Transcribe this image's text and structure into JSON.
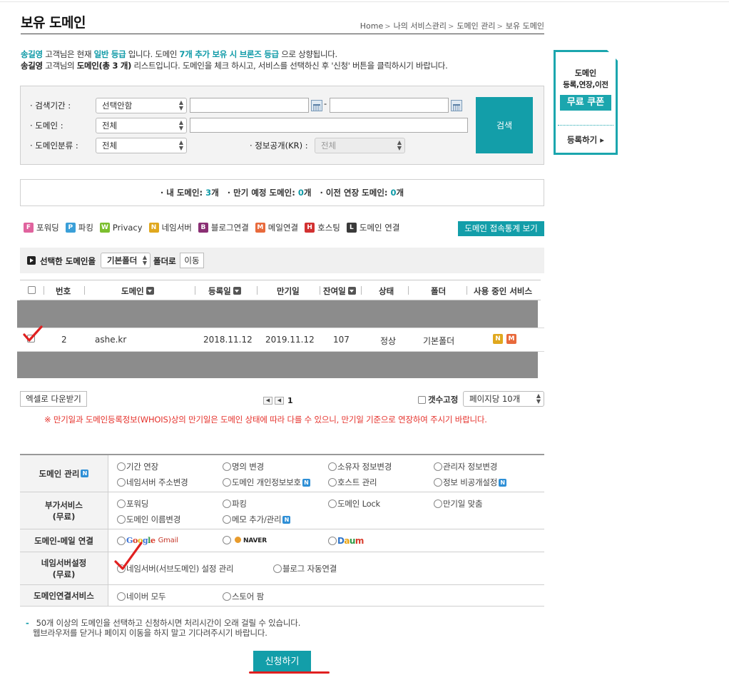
{
  "page": {
    "title": "보유 도메인",
    "breadcrumb": [
      "Home",
      "나의 서비스관리",
      "도메인 관리",
      "보유 도메인"
    ]
  },
  "notice": {
    "line1_name": "송길영",
    "line1_a": " 고객님은 현재 ",
    "line1_grade": "일반 등급",
    "line1_b": " 입니다. 도메인 ",
    "line1_more": "7개 추가 보유 시 브론즈 등급",
    "line1_c": " 으로 상향됩니다.",
    "line2_name": "송길영",
    "line2_a": " 고객님의 ",
    "line2_domain": "도메인(총 3 개)",
    "line2_b": " 리스트입니다. 도메인을 체크 하시고, 서비스를 선택하신 후 '신청' 버튼을 클릭하시기 바랍니다."
  },
  "search": {
    "period_label": "· 검색기간 :",
    "period_select": "선택안함",
    "date_sep": "-",
    "domain_label": "· 도메인 :",
    "domain_select": "전체",
    "category_label": "· 도메인분류 :",
    "category_select": "전체",
    "privacy_label": "· 정보공개(KR) :",
    "privacy_select": "전체",
    "button": "검색"
  },
  "coupon": {
    "line1": "도메인",
    "line2": "등록,연장,이전",
    "free": "무료 쿠폰",
    "register": "등록하기 ▸"
  },
  "summary": {
    "my_label": "· 내 도메인: ",
    "my_count": "3",
    "my_unit": "개",
    "expiring_label": "· 만기 예정 도메인: ",
    "expiring_count": "0",
    "expiring_unit": "개",
    "transfer_label": "· 이전 연장 도메인: ",
    "transfer_count": "0",
    "transfer_unit": "개"
  },
  "legend": {
    "items": [
      {
        "letter": "F",
        "label": "포워딩",
        "color": "#e0639e"
      },
      {
        "letter": "P",
        "label": "파킹",
        "color": "#3a9fd8"
      },
      {
        "letter": "W",
        "label": "Privacy",
        "color": "#7cbf2f"
      },
      {
        "letter": "N",
        "label": "네임서버",
        "color": "#e0a81e"
      },
      {
        "letter": "B",
        "label": "블로그연결",
        "color": "#8a2f74"
      },
      {
        "letter": "M",
        "label": "메일연결",
        "color": "#e86a3c"
      },
      {
        "letter": "H",
        "label": "호스팅",
        "color": "#d23131"
      },
      {
        "letter": "L",
        "label": "도메인 연결",
        "color": "#3a3a3a"
      }
    ],
    "stats_button": "도메인 접속통계 보기"
  },
  "move": {
    "label": "선택한 도메인을",
    "folder_select": "기본폴더",
    "to_label": "폴더로",
    "button": "이동"
  },
  "table": {
    "headers": {
      "no": "번호",
      "domain": "도메인",
      "registered": "등록일",
      "expires": "만기일",
      "remaining": "잔여일",
      "status": "상태",
      "folder": "폴더",
      "services": "사용 중인 서비스"
    },
    "row": {
      "no": "2",
      "domain": "ashe.kr",
      "registered": "2018.11.12",
      "expires": "2019.11.12",
      "remaining": "107",
      "status": "정상",
      "folder": "기본폴더",
      "badge1": "N",
      "badge2": "M"
    }
  },
  "bottom": {
    "excel": "엑셀로 다운받기",
    "pager_first": "◀",
    "pager_prev": "◀",
    "page": "1",
    "fix_label": "갯수고정",
    "per_page": "페이지당 10개",
    "warning": "※ 만기일과 도메인등록정보(WHOIS)상의 만기일은 도메인 상태에 따라 다를 수 있으니, 만기일 기준으로 연장하여 주시기 바랍니다."
  },
  "services": {
    "domain_mgmt": {
      "label": "도메인 관리",
      "options": [
        "기간 연장",
        "명의 변경",
        "소유자 정보변경",
        "관리자 정보변경",
        "네임서버 주소변경",
        "도메인 개인정보보호",
        "호스트 관리",
        "정보 비공개설정"
      ]
    },
    "addon": {
      "label1": "부가서비스",
      "label2": "(무료)",
      "options": [
        "포워딩",
        "파킹",
        "도메인 Lock",
        "만기일 맞춤",
        "도메인 이름변경",
        "메모 추가/관리"
      ]
    },
    "mail": {
      "label": "도메인-메일 연결",
      "google_parts": [
        "G",
        "o",
        "o",
        "g",
        "l",
        "e"
      ],
      "gmail": "Gmail",
      "naver": "NAVER",
      "daum_parts": [
        "D",
        "a",
        "u",
        "m"
      ]
    },
    "ns": {
      "label1": "네임서버설정",
      "label2": "(무료)",
      "options": [
        "네임서버(서브도메인) 설정 관리",
        "블로그 자동연결"
      ]
    },
    "link": {
      "label": "도메인연결서비스",
      "options": [
        "네이버 모두",
        "스토어 팜"
      ]
    },
    "new_badge": "N"
  },
  "footer": {
    "dash": "-",
    "line1": "50개 이상의 도메인을 선택하고 신청하시면 처리시간이 오래 걸릴 수 있습니다.",
    "line2": "웹브라우저를 닫거나 페이지 이동을 하지 말고 기다려주시기 바랍니다.",
    "apply": "신청하기"
  },
  "colors": {
    "accent": "#139ea9",
    "warning": "#e5312b",
    "annotation": "#e02020"
  }
}
